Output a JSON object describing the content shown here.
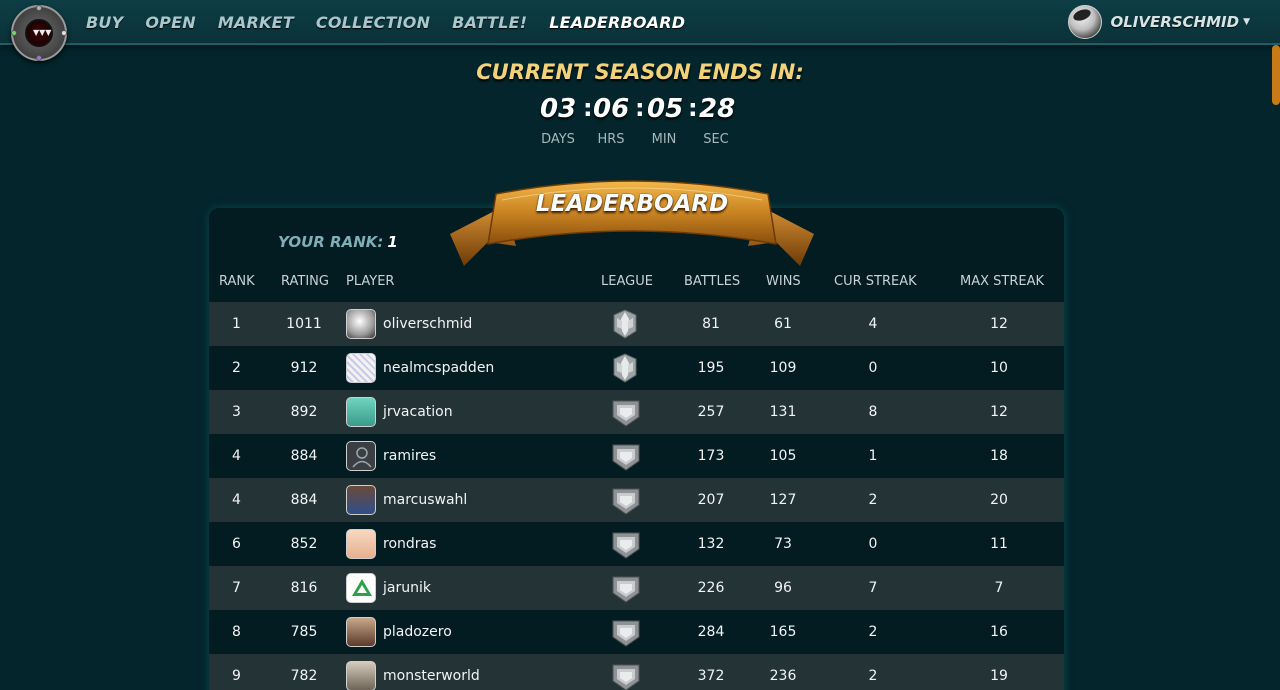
{
  "nav": {
    "items": [
      {
        "label": "BUY",
        "active": false
      },
      {
        "label": "OPEN",
        "active": false
      },
      {
        "label": "MARKET",
        "active": false
      },
      {
        "label": "COLLECTION",
        "active": false
      },
      {
        "label": "BATTLE!",
        "active": false
      },
      {
        "label": "LEADERBOARD",
        "active": true
      }
    ],
    "username": "OLIVERSCHMID"
  },
  "season": {
    "title": "CURRENT SEASON ENDS IN:",
    "days": "03",
    "hrs": "06",
    "min": "05",
    "sec": "28",
    "labels": {
      "days": "DAYS",
      "hrs": "HRS",
      "min": "MIN",
      "sec": "SEC"
    }
  },
  "leaderboard": {
    "title": "LEADERBOARD",
    "your_rank_label": "YOUR RANK:",
    "your_rank_value": "1",
    "headers": {
      "rank": "RANK",
      "rating": "RATING",
      "player": "PLAYER",
      "league": "LEAGUE",
      "battles": "BATTLES",
      "wins": "WINS",
      "cur_streak": "CUR STREAK",
      "max_streak": "MAX STREAK"
    },
    "rows": [
      {
        "rank": "1",
        "rating": "1011",
        "player": "oliverschmid",
        "league": "silver-league-icon",
        "battles": "81",
        "wins": "61",
        "cur_streak": "4",
        "max_streak": "12"
      },
      {
        "rank": "2",
        "rating": "912",
        "player": "nealmcspadden",
        "league": "silver-league-icon",
        "battles": "195",
        "wins": "109",
        "cur_streak": "0",
        "max_streak": "10"
      },
      {
        "rank": "3",
        "rating": "892",
        "player": "jrvacation",
        "league": "bronze-league-icon",
        "battles": "257",
        "wins": "131",
        "cur_streak": "8",
        "max_streak": "12"
      },
      {
        "rank": "4",
        "rating": "884",
        "player": "ramires",
        "league": "bronze-league-icon",
        "battles": "173",
        "wins": "105",
        "cur_streak": "1",
        "max_streak": "18"
      },
      {
        "rank": "4",
        "rating": "884",
        "player": "marcuswahl",
        "league": "bronze-league-icon",
        "battles": "207",
        "wins": "127",
        "cur_streak": "2",
        "max_streak": "20"
      },
      {
        "rank": "6",
        "rating": "852",
        "player": "rondras",
        "league": "bronze-league-icon",
        "battles": "132",
        "wins": "73",
        "cur_streak": "0",
        "max_streak": "11"
      },
      {
        "rank": "7",
        "rating": "816",
        "player": "jarunik",
        "league": "bronze-league-icon",
        "battles": "226",
        "wins": "96",
        "cur_streak": "7",
        "max_streak": "7"
      },
      {
        "rank": "8",
        "rating": "785",
        "player": "pladozero",
        "league": "bronze-league-icon",
        "battles": "284",
        "wins": "165",
        "cur_streak": "2",
        "max_streak": "16"
      },
      {
        "rank": "9",
        "rating": "782",
        "player": "monsterworld",
        "league": "bronze-league-icon",
        "battles": "372",
        "wins": "236",
        "cur_streak": "2",
        "max_streak": "19"
      }
    ]
  },
  "colors": {
    "background": "#03252b",
    "gold": "#f2d37a",
    "banner": "#c8861e",
    "row_odd": "#243436",
    "row_even": "#031c21"
  }
}
